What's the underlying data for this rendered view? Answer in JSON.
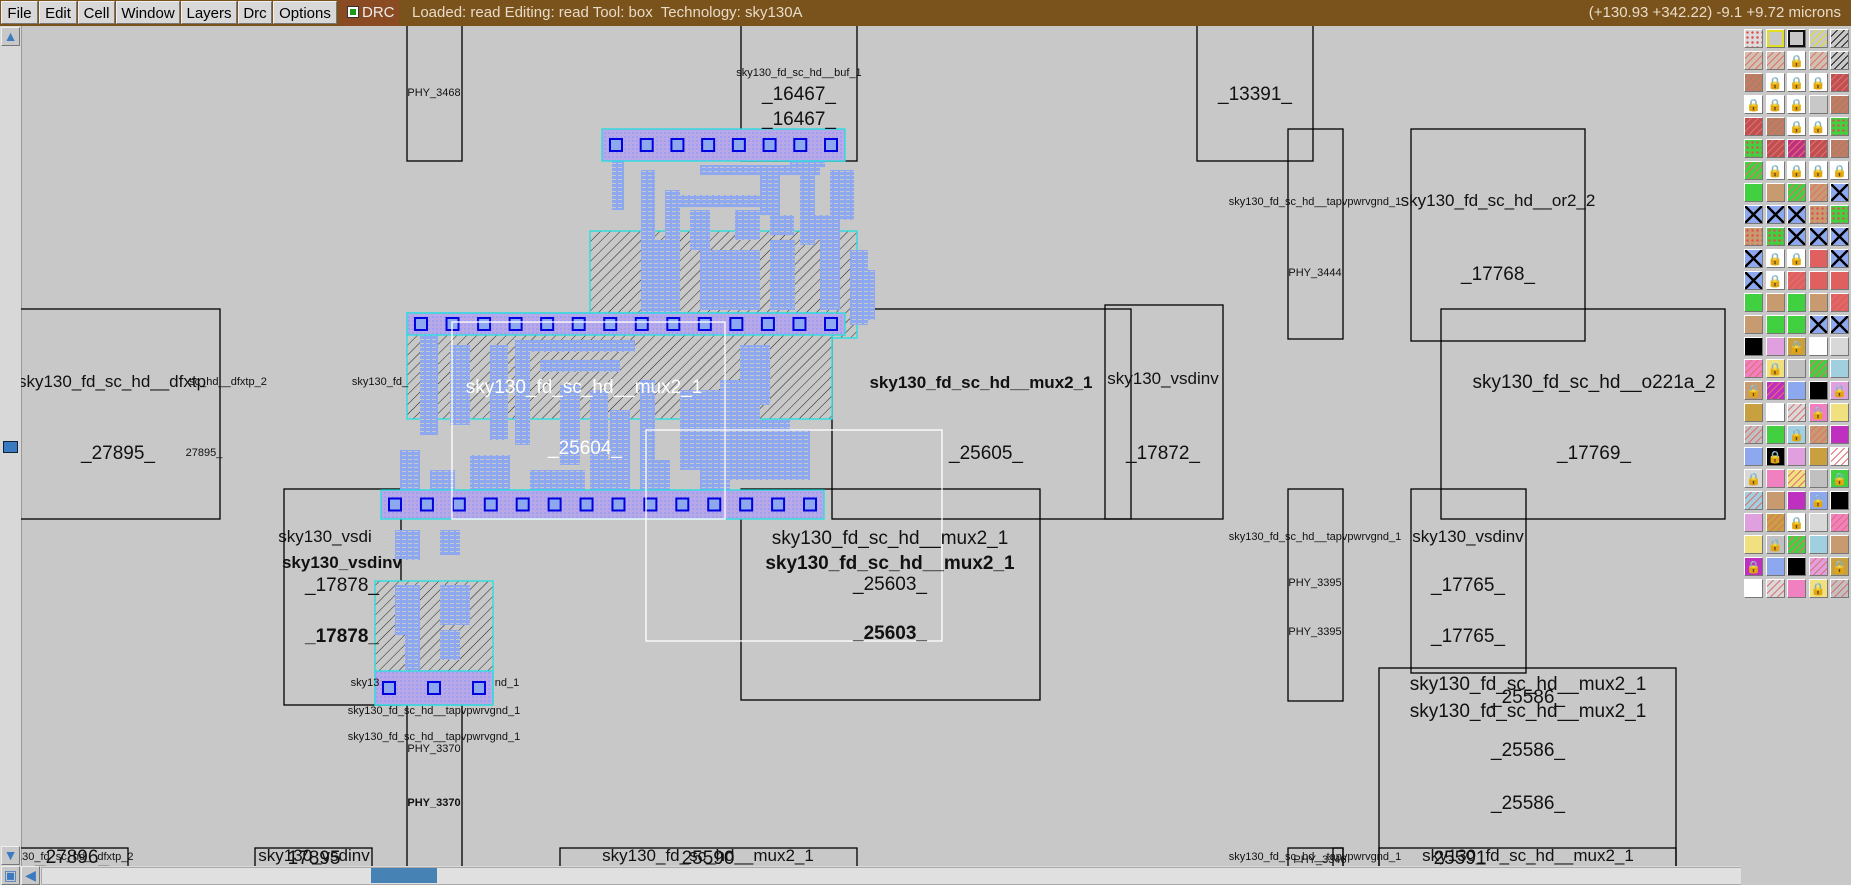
{
  "menubar": {
    "items": [
      "File",
      "Edit",
      "Cell",
      "Window",
      "Layers",
      "Drc",
      "Options"
    ]
  },
  "drc_toggle": {
    "label": "DRC",
    "checked": true
  },
  "status": "Loaded: read Editing: read Tool: box  Technology: sky130A",
  "cursor_readout": "(+130.93 +342.22) -9.1 +9.72 microns",
  "colors": {
    "titlebar": "#7a521c",
    "canvas": "#c8c8c8",
    "metal1": "#8ea8f0",
    "contact": "#0000e0",
    "outline": "#20e0e0",
    "selection": "#ffffff"
  },
  "labels": [
    "PHY_3468",
    "sky130_fd_sc_hd__buf_1",
    "_16467_",
    "_16467_",
    "_13391_",
    "sky130_fd_sc_hd__tapvpwrvgnd_1",
    "PHY_3444",
    "sky130_fd_sc_hd__or2_2",
    "_17768_",
    "sky130_fd_sc_hd__dfxtp",
    "sc_hd__dfxtp_2",
    "_27895_",
    "27895_",
    "sky130_fd_",
    "sky130_fd_sc_hd__mux2_1",
    "_25605_",
    "sky130_vsdinv",
    "_17872_",
    "sky130_fd_sc_hd__o221a_2",
    "_17769_",
    "sky130_vsdi",
    "sky130_vsdinv",
    "_17878_",
    "_17878_",
    "sky130_fd_sc_hd__mux2_1",
    "sky130_fd_sc_hd__mux2_1",
    "_25603_",
    "_25603_",
    "sky130_fd_sc_hd__tapvpwrvgnd_1",
    "PHY_3395",
    "PHY_3395",
    "sky130_vsdinv",
    "_17765_",
    "_17765_",
    "sky130_fd_sc_hd__mux2_1",
    "_25586_",
    "sky130_fd_sc_hd__mux2_1",
    "_25586_",
    "_25586_",
    "sky13",
    "nd_1",
    "sky130_fd_sc_hd__tapvpwrvgnd_1",
    "sky130_fd_sc_hd__tapvpwrvgnd_1",
    "PHY_3370",
    "PHY_3370",
    "sky130_fd_sc_hd__mux2_1",
    "_25604_",
    "y130_fd_sc_hd__dfxtp_2",
    "_27896_",
    "sky130_vsdinv",
    "_17895_",
    "sky130_fd_sc_hd__mux2_1",
    "_25590_",
    "sky130_fd_sc_hd__tapvpwrvgnd_1",
    "PHY_3346",
    "sky130_fd_sc_hd__mux2_1",
    "_25591_"
  ],
  "scrollbars": {
    "vertical_icons": [
      "arrow-up",
      "arrow-down"
    ],
    "horizontal_icons": [
      "zoom-box",
      "arrow-left"
    ]
  },
  "layer_palette": {
    "rows": 26,
    "columns": 5
  }
}
